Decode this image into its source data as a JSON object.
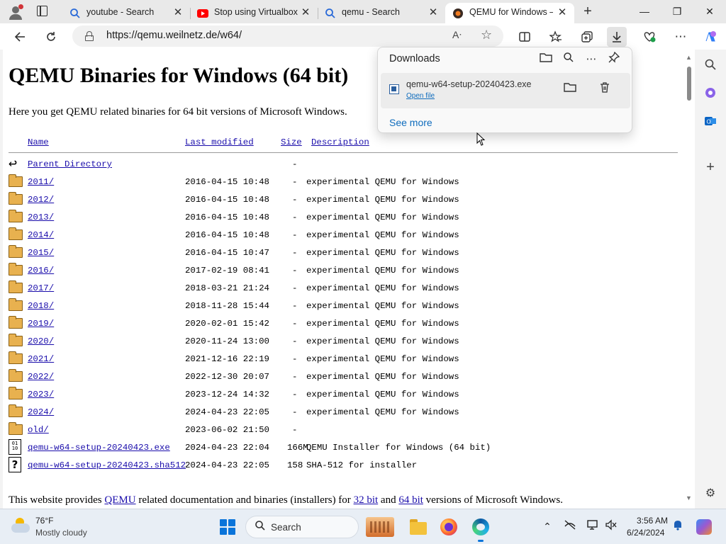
{
  "tabs": [
    {
      "title": "youtube - Search",
      "icon": "search-favicon"
    },
    {
      "title": "Stop using Virtualbox",
      "icon": "youtube-favicon"
    },
    {
      "title": "qemu - Search",
      "icon": "search-favicon"
    },
    {
      "title": "QEMU for Windows –",
      "icon": "qemu-favicon",
      "active": true
    }
  ],
  "tab_close_glyph": "✕",
  "address_bar": {
    "url": "https://qemu.weilnetz.de/w64/"
  },
  "page": {
    "heading": "QEMU Binaries for Windows (64 bit)",
    "intro": "Here you get QEMU related binaries for 64 bit versions of Microsoft Windows.",
    "columns": {
      "name": "Name",
      "modified": "Last modified",
      "size": "Size",
      "description": "Description"
    },
    "parent": {
      "name": "Parent Directory",
      "size": "-"
    },
    "entries": [
      {
        "type": "folder",
        "name": "2011/",
        "modified": "2016-04-15 10:48",
        "size": "-",
        "description": "experimental QEMU for Windows"
      },
      {
        "type": "folder",
        "name": "2012/",
        "modified": "2016-04-15 10:48",
        "size": "-",
        "description": "experimental QEMU for Windows"
      },
      {
        "type": "folder",
        "name": "2013/",
        "modified": "2016-04-15 10:48",
        "size": "-",
        "description": "experimental QEMU for Windows"
      },
      {
        "type": "folder",
        "name": "2014/",
        "modified": "2016-04-15 10:48",
        "size": "-",
        "description": "experimental QEMU for Windows"
      },
      {
        "type": "folder",
        "name": "2015/",
        "modified": "2016-04-15 10:47",
        "size": "-",
        "description": "experimental QEMU for Windows"
      },
      {
        "type": "folder",
        "name": "2016/",
        "modified": "2017-02-19 08:41",
        "size": "-",
        "description": "experimental QEMU for Windows"
      },
      {
        "type": "folder",
        "name": "2017/",
        "modified": "2018-03-21 21:24",
        "size": "-",
        "description": "experimental QEMU for Windows"
      },
      {
        "type": "folder",
        "name": "2018/",
        "modified": "2018-11-28 15:44",
        "size": "-",
        "description": "experimental QEMU for Windows"
      },
      {
        "type": "folder",
        "name": "2019/",
        "modified": "2020-02-01 15:42",
        "size": "-",
        "description": "experimental QEMU for Windows"
      },
      {
        "type": "folder",
        "name": "2020/",
        "modified": "2020-11-24 13:00",
        "size": "-",
        "description": "experimental QEMU for Windows"
      },
      {
        "type": "folder",
        "name": "2021/",
        "modified": "2021-12-16 22:19",
        "size": "-",
        "description": "experimental QEMU for Windows"
      },
      {
        "type": "folder",
        "name": "2022/",
        "modified": "2022-12-30 20:07",
        "size": "-",
        "description": "experimental QEMU for Windows"
      },
      {
        "type": "folder",
        "name": "2023/",
        "modified": "2023-12-24 14:32",
        "size": "-",
        "description": "experimental QEMU for Windows"
      },
      {
        "type": "folder",
        "name": "2024/",
        "modified": "2024-04-23 22:05",
        "size": "-",
        "description": "experimental QEMU for Windows"
      },
      {
        "type": "folder",
        "name": "old/",
        "modified": "2023-06-02 21:50",
        "size": "-",
        "description": ""
      },
      {
        "type": "binary",
        "name": "qemu-w64-setup-20240423.exe",
        "modified": "2024-04-23 22:04",
        "size": "166M",
        "description": "QEMU Installer for Windows (64 bit)"
      },
      {
        "type": "unknown",
        "name": "qemu-w64-setup-20240423.sha512",
        "modified": "2024-04-23 22:05",
        "size": "158",
        "description": "SHA-512 for installer"
      }
    ],
    "footer": {
      "before": "This website provides ",
      "link1": "QEMU",
      "middle1": " related documentation and binaries (installers) for ",
      "link2": "32 bit",
      "middle2": " and ",
      "link3": "64 bit",
      "after": " versions of Microsoft Windows."
    }
  },
  "downloads": {
    "title": "Downloads",
    "file_name": "qemu-w64-setup-20240423.exe",
    "open_file": "Open file",
    "see_more": "See more"
  },
  "taskbar": {
    "temperature": "76°F",
    "condition": "Mostly cloudy",
    "search_label": "Search",
    "time": "3:56 AM",
    "date": "6/24/2024"
  },
  "colors": {
    "link": "#1a0dab",
    "accent": "#0f6cbd",
    "folder": "#e8b14f"
  }
}
